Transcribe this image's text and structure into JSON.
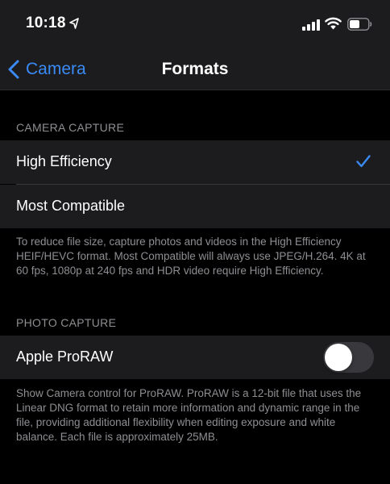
{
  "status_bar": {
    "time": "10:18"
  },
  "nav": {
    "back_label": "Camera",
    "title": "Formats"
  },
  "camera_capture": {
    "header": "CAMERA CAPTURE",
    "options": [
      {
        "label": "High Efficiency",
        "selected": true
      },
      {
        "label": "Most Compatible",
        "selected": false
      }
    ],
    "footer": "To reduce file size, capture photos and videos in the High Efficiency HEIF/HEVC format. Most Compatible will always use JPEG/H.264. 4K at 60 fps, 1080p at 240 fps and HDR video require High Efficiency."
  },
  "photo_capture": {
    "header": "PHOTO CAPTURE",
    "proraw_label": "Apple ProRAW",
    "proraw_enabled": false,
    "footer": "Show Camera control for ProRAW. ProRAW is a 12-bit file that uses the Linear DNG format to retain more information and dynamic range in the file, providing additional flexibility when editing exposure and white balance. Each file is approximately 25MB."
  },
  "colors": {
    "accent": "#3a8bf5",
    "background": "#000000",
    "cell": "#1c1c1e",
    "secondary_text": "#8e8e93",
    "toggle_off": "#39393d"
  },
  "icons": {
    "location": "location-arrow-icon",
    "signal": "cellular-signal-icon",
    "wifi": "wifi-icon",
    "battery": "battery-icon",
    "back": "chevron-left-icon",
    "check": "checkmark-icon"
  }
}
